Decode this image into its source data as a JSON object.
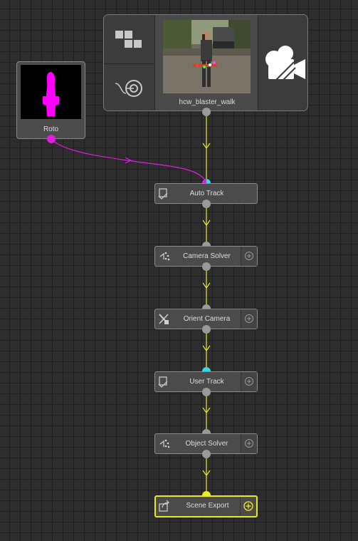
{
  "source_node": {
    "label": "hcw_blaster_walk"
  },
  "roto_node": {
    "label": "Roto"
  },
  "nodes": [
    {
      "label": "Auto Track",
      "icon": "auto-track-icon"
    },
    {
      "label": "Camera Solver",
      "icon": "camera-solver-icon"
    },
    {
      "label": "Orient Camera",
      "icon": "orient-camera-icon"
    },
    {
      "label": "User Track",
      "icon": "user-track-icon"
    },
    {
      "label": "Object Solver",
      "icon": "object-solver-icon"
    },
    {
      "label": "Scene Export",
      "icon": "scene-export-icon",
      "active": true
    }
  ],
  "colors": {
    "background": "#2d2d2d",
    "wire_main": "#e6e62a",
    "wire_mask": "#e01ee0",
    "port_default": "#9a9a9a",
    "port_mask_input": "#37d7e6",
    "active_outline": "#e8e81e"
  }
}
